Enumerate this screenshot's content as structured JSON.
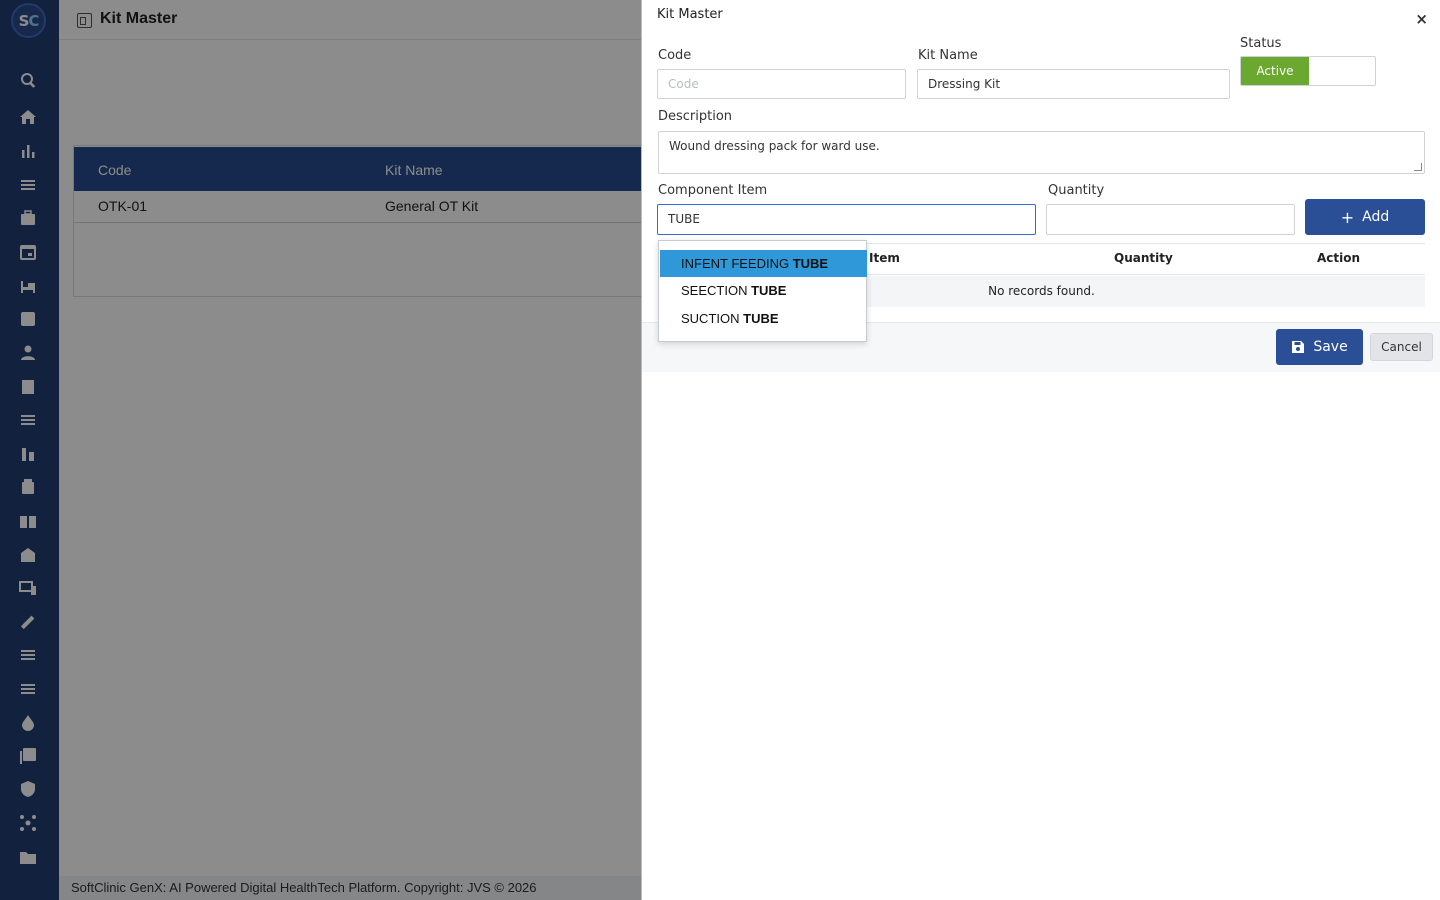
{
  "app": {
    "logo_s": "S",
    "logo_c": "C",
    "header_title": "Kit Master",
    "footer": "SoftClinic GenX: AI Powered Digital HealthTech Platform. Copyright: JVS © 2026"
  },
  "sidebar": {
    "icons": [
      "search-icon",
      "home-icon",
      "bar-chart-icon",
      "menu-icon",
      "medical-bag-icon",
      "calendar-icon",
      "bed-icon",
      "add-box-icon",
      "person-icon",
      "receipt-icon",
      "menu-icon",
      "lab-icon",
      "medicine-icon",
      "book-icon",
      "store-icon",
      "devices-icon",
      "wrench-icon",
      "menu-icon",
      "menu-icon",
      "drop-icon",
      "library-add-icon",
      "shield-icon",
      "network-icon",
      "folder-icon"
    ]
  },
  "background_table": {
    "headers": [
      "Code",
      "Kit Name"
    ],
    "rows": [
      [
        "OTK-01",
        "General OT Kit"
      ]
    ]
  },
  "modal": {
    "title": "Kit Master",
    "close": "×",
    "code_label": "Code",
    "code_placeholder": "Code",
    "kitname_label": "Kit Name",
    "kitname_value": "Dressing Kit",
    "status_label": "Status",
    "status_value": "Active",
    "description_label": "Description",
    "description_value": "Wound dressing pack for ward use.",
    "component_label": "Component Item",
    "component_value": "TUBE",
    "quantity_label": "Quantity",
    "quantity_value": "",
    "add_label": "Add",
    "table_headers": [
      "Item",
      "Quantity",
      "Action"
    ],
    "empty_text": "No records found.",
    "save_label": "Save",
    "cancel_label": "Cancel",
    "suggestions": [
      {
        "prefix": "INFENT FEEDING ",
        "match": "TUBE",
        "selected": true
      },
      {
        "prefix": "SEECTION ",
        "match": "TUBE",
        "selected": false
      },
      {
        "prefix": "SUCTION ",
        "match": "TUBE",
        "selected": false
      }
    ]
  },
  "colors": {
    "sidebar": "#223d72",
    "primary_button": "#2a4f97",
    "status_active": "#6aa830",
    "selected_suggestion": "#2e98d8"
  }
}
